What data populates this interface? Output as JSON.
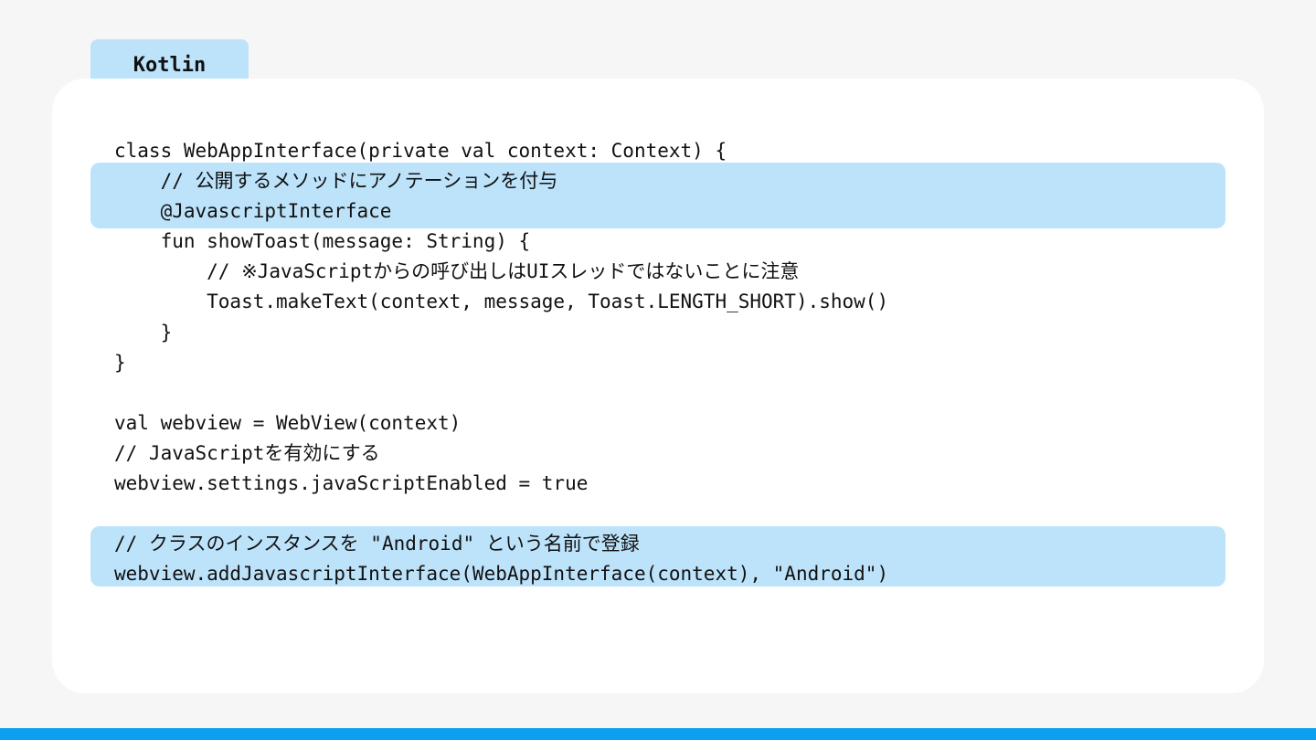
{
  "language_tab": {
    "label": "Kotlin"
  },
  "code": {
    "lines": [
      "class WebAppInterface(private val context: Context) {",
      "    // 公開するメソッドにアノテーションを付与",
      "    @JavascriptInterface",
      "    fun showToast(message: String) {",
      "        // ※JavaScriptからの呼び出しはUIスレッドではないことに注意",
      "        Toast.makeText(context, message, Toast.LENGTH_SHORT).show()",
      "    }",
      "}",
      "",
      "val webview = WebView(context)",
      "// JavaScriptを有効にする",
      "webview.settings.javaScriptEnabled = true",
      "",
      "// クラスのインスタンスを \"Android\" という名前で登録",
      "webview.addJavascriptInterface(WebAppInterface(context), \"Android\")"
    ]
  },
  "colors": {
    "background": "#f6f6f6",
    "card": "#ffffff",
    "highlight": "#bde3fb",
    "accent_bar": "#0ea0f0",
    "text": "#111111"
  }
}
